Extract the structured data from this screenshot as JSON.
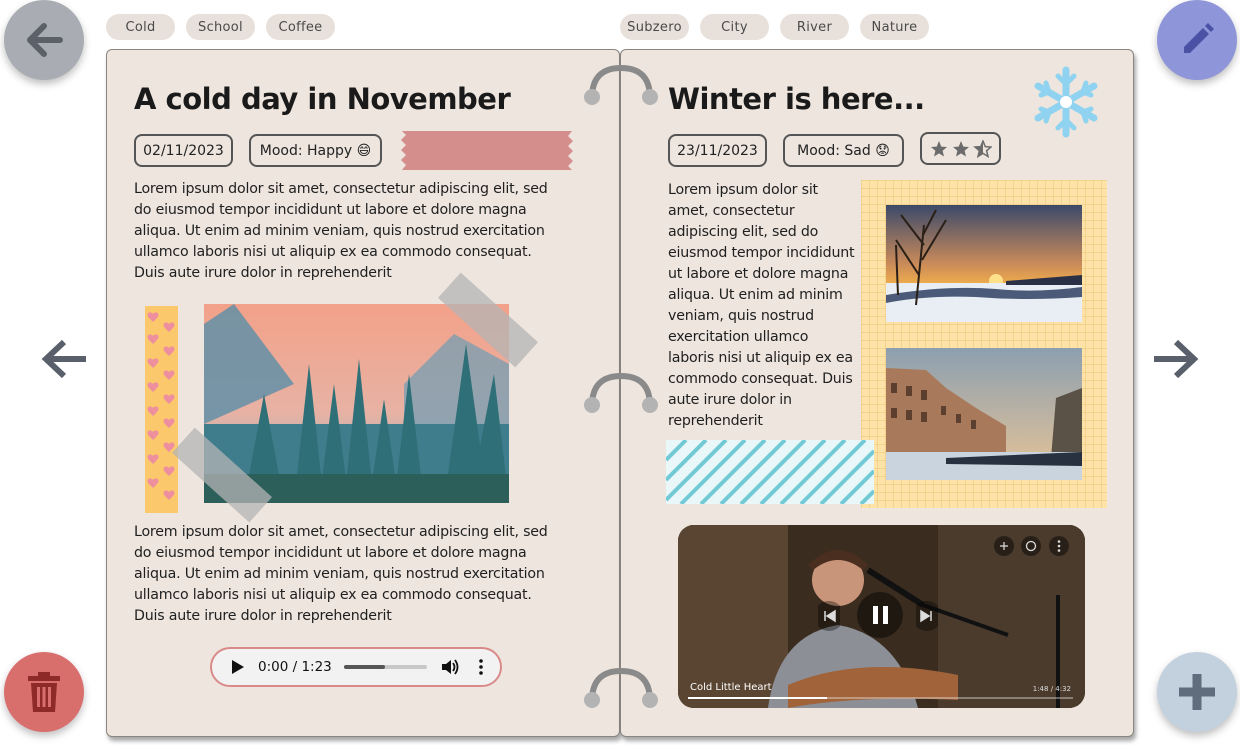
{
  "tags": {
    "left": [
      "Cold",
      "School",
      "Coffee"
    ],
    "right": [
      "Subzero",
      "City",
      "River",
      "Nature"
    ]
  },
  "left_entry": {
    "title": "A cold day in November",
    "date": "02/11/2023",
    "mood": "Mood: Happy 😄",
    "paragraph1": "Lorem ipsum dolor sit amet, consectetur adipiscing elit, sed do eiusmod tempor incididunt ut labore et dolore magna aliqua. Ut enim ad minim veniam, quis nostrud exercitation ullamco laboris nisi ut aliquip ex ea commodo consequat. Duis aute irure dolor in reprehenderit",
    "paragraph2": "Lorem ipsum dolor sit amet, consectetur adipiscing elit, sed do eiusmod tempor incididunt ut labore et dolore magna aliqua. Ut enim ad minim veniam, quis nostrud exercitation ullamco laboris nisi ut aliquip ex ea commodo consequat. Duis aute irure dolor in reprehenderit",
    "audio": {
      "time": "0:00 / 1:23",
      "progress": 0.5
    }
  },
  "right_entry": {
    "title": "Winter is here...",
    "date": "23/11/2023",
    "mood": "Mood: Sad 😟",
    "rating": 2.5,
    "paragraph": "Lorem ipsum dolor sit amet, consectetur adipiscing elit, sed do eiusmod tempor incididunt ut labore et dolore magna aliqua. Ut enim ad minim veniam, quis nostrud exercitation ullamco laboris nisi ut aliquip ex ea commodo consequat. Duis aute irure dolor in reprehenderit",
    "video": {
      "title": "Cold Little Heart",
      "time": "1:48 / 4:32",
      "progress": 0.36
    }
  },
  "icons": {
    "back": "arrow-left-icon",
    "edit": "pencil-icon",
    "delete": "trash-icon",
    "add": "plus-icon",
    "prev": "arrow-left-icon",
    "next": "arrow-right-icon",
    "sticker": "snowflake-icon"
  },
  "colors": {
    "page": "#ede5de",
    "back_fab": "#a9adb3",
    "edit_fab": "#8e95d8",
    "delete_fab": "#d96f6d",
    "add_fab": "#c3d1de",
    "tape_pink": "#d48e8c",
    "grid_paper": "#fde3a7",
    "audio_border": "#d98a88"
  }
}
